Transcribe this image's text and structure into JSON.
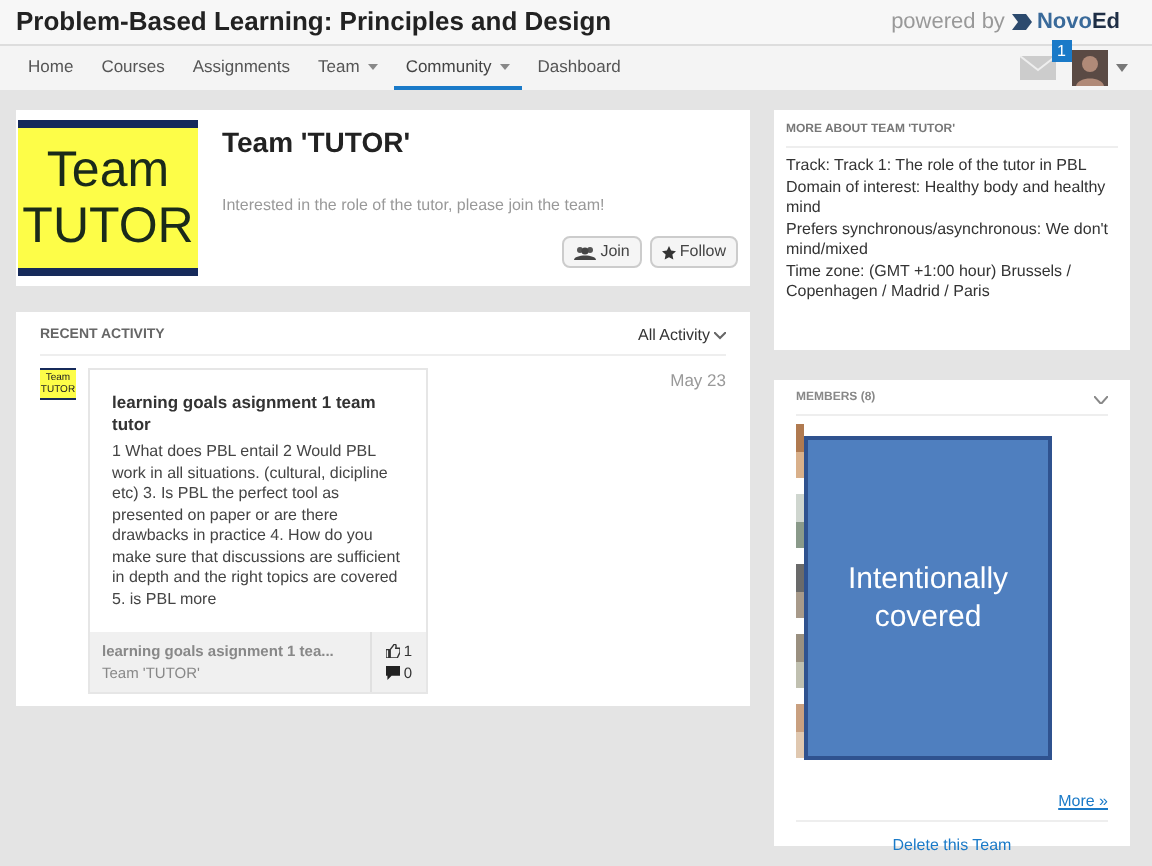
{
  "header": {
    "title": "Problem-Based Learning: Principles and Design",
    "powered_by": "powered by",
    "brand_parts": [
      "Novo",
      "Ed"
    ]
  },
  "nav": {
    "items": [
      {
        "label": "Home",
        "dropdown": false,
        "selected": false
      },
      {
        "label": "Courses",
        "dropdown": false,
        "selected": false
      },
      {
        "label": "Assignments",
        "dropdown": false,
        "selected": false
      },
      {
        "label": "Team",
        "dropdown": true,
        "selected": false
      },
      {
        "label": "Community",
        "dropdown": true,
        "selected": true
      },
      {
        "label": "Dashboard",
        "dropdown": false,
        "selected": false
      }
    ],
    "message_count": "1"
  },
  "team": {
    "logo_lines": [
      "Team",
      "TUTOR"
    ],
    "title": "Team 'TUTOR'",
    "description": "Interested in the role of the tutor, please join the team!",
    "buttons": [
      {
        "kind": "join",
        "label": "Join"
      },
      {
        "kind": "follow",
        "label": "Follow"
      }
    ]
  },
  "activity": {
    "heading": "RECENT ACTIVITY",
    "filter": "All Activity",
    "items": [
      {
        "thumb_lines": [
          "Team",
          "TUTOR"
        ],
        "date": "May 23",
        "title": "learning goals asignment 1 team tutor",
        "body": "1 What does PBL entail 2 Would PBL work in all situations. (cultural, dicipline etc) 3. Is PBL the perfect tool as presented on paper or are there drawbacks in practice 4. How do you make sure that discussions are sufficient in depth and the right topics are covered 5. is PBL more",
        "footer_title": "learning goals asignment 1 tea...",
        "footer_team": "Team 'TUTOR'",
        "likes": "1",
        "comments": "0"
      }
    ]
  },
  "about": {
    "heading": "MORE ABOUT TEAM 'TUTOR'",
    "lines": [
      "Track: Track 1: The role of the tutor in PBL",
      "Domain of interest: Healthy body and healthy mind",
      "Prefers synchronous/asynchronous: We don't mind/mixed",
      "Time zone: (GMT +1:00 hour) Brussels / Copenhagen / Madrid / Paris"
    ]
  },
  "members": {
    "heading": "MEMBERS (8)",
    "more": "More »",
    "delete": "Delete this Team"
  },
  "overlay": {
    "text": "Intentionally covered"
  }
}
